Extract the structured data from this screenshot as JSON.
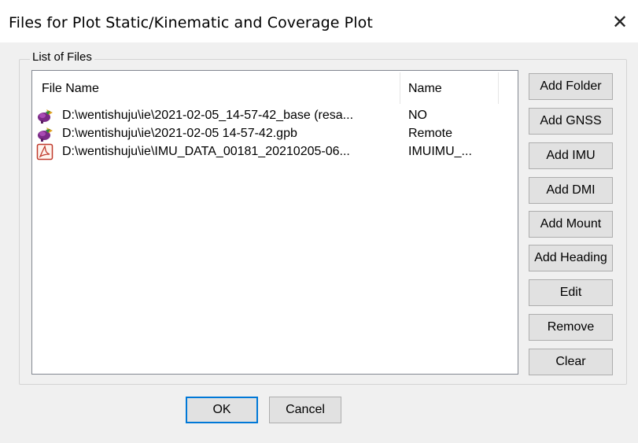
{
  "window": {
    "title": "Files for Plot Static/Kinematic and Coverage Plot",
    "close_glyph": "✕"
  },
  "group": {
    "label": "List of Files"
  },
  "list": {
    "columns": [
      "File Name",
      "Name"
    ],
    "rows": [
      {
        "icon": "gnss-file-icon",
        "file_name": "D:\\wentishuju\\ie\\2021-02-05_14-57-42_base (resa...",
        "name": "NO"
      },
      {
        "icon": "gnss-file-icon",
        "file_name": "D:\\wentishuju\\ie\\2021-02-05 14-57-42.gpb",
        "name": "Remote"
      },
      {
        "icon": "pdf-file-icon",
        "file_name": "D:\\wentishuju\\ie\\IMU_DATA_00181_20210205-06...",
        "name": "IMUIMU_..."
      }
    ]
  },
  "side_buttons": [
    {
      "id": "add-folder-button",
      "label": "Add Folder"
    },
    {
      "id": "add-gnss-button",
      "label": "Add GNSS"
    },
    {
      "id": "add-imu-button",
      "label": "Add IMU"
    },
    {
      "id": "add-dmi-button",
      "label": "Add DMI"
    },
    {
      "id": "add-mount-button",
      "label": "Add Mount"
    },
    {
      "id": "add-heading-button",
      "label": "Add Heading"
    },
    {
      "id": "edit-button",
      "label": "Edit"
    },
    {
      "id": "remove-button",
      "label": "Remove"
    },
    {
      "id": "clear-button",
      "label": "Clear"
    }
  ],
  "footer": {
    "ok_label": "OK",
    "cancel_label": "Cancel"
  }
}
